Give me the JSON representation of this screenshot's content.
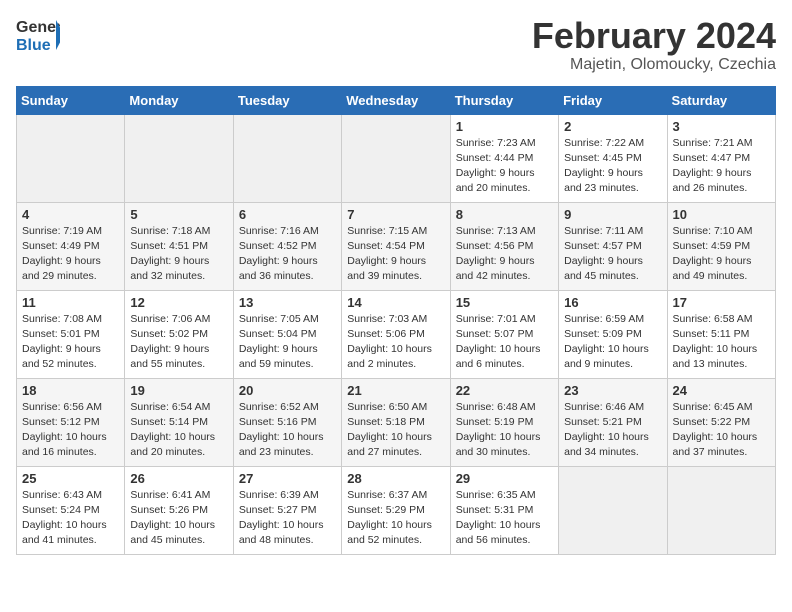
{
  "header": {
    "logo_line1": "General",
    "logo_line2": "Blue",
    "month": "February 2024",
    "location": "Majetin, Olomoucky, Czechia"
  },
  "weekdays": [
    "Sunday",
    "Monday",
    "Tuesday",
    "Wednesday",
    "Thursday",
    "Friday",
    "Saturday"
  ],
  "weeks": [
    [
      {
        "day": "",
        "info": ""
      },
      {
        "day": "",
        "info": ""
      },
      {
        "day": "",
        "info": ""
      },
      {
        "day": "",
        "info": ""
      },
      {
        "day": "1",
        "info": "Sunrise: 7:23 AM\nSunset: 4:44 PM\nDaylight: 9 hours\nand 20 minutes."
      },
      {
        "day": "2",
        "info": "Sunrise: 7:22 AM\nSunset: 4:45 PM\nDaylight: 9 hours\nand 23 minutes."
      },
      {
        "day": "3",
        "info": "Sunrise: 7:21 AM\nSunset: 4:47 PM\nDaylight: 9 hours\nand 26 minutes."
      }
    ],
    [
      {
        "day": "4",
        "info": "Sunrise: 7:19 AM\nSunset: 4:49 PM\nDaylight: 9 hours\nand 29 minutes."
      },
      {
        "day": "5",
        "info": "Sunrise: 7:18 AM\nSunset: 4:51 PM\nDaylight: 9 hours\nand 32 minutes."
      },
      {
        "day": "6",
        "info": "Sunrise: 7:16 AM\nSunset: 4:52 PM\nDaylight: 9 hours\nand 36 minutes."
      },
      {
        "day": "7",
        "info": "Sunrise: 7:15 AM\nSunset: 4:54 PM\nDaylight: 9 hours\nand 39 minutes."
      },
      {
        "day": "8",
        "info": "Sunrise: 7:13 AM\nSunset: 4:56 PM\nDaylight: 9 hours\nand 42 minutes."
      },
      {
        "day": "9",
        "info": "Sunrise: 7:11 AM\nSunset: 4:57 PM\nDaylight: 9 hours\nand 45 minutes."
      },
      {
        "day": "10",
        "info": "Sunrise: 7:10 AM\nSunset: 4:59 PM\nDaylight: 9 hours\nand 49 minutes."
      }
    ],
    [
      {
        "day": "11",
        "info": "Sunrise: 7:08 AM\nSunset: 5:01 PM\nDaylight: 9 hours\nand 52 minutes."
      },
      {
        "day": "12",
        "info": "Sunrise: 7:06 AM\nSunset: 5:02 PM\nDaylight: 9 hours\nand 55 minutes."
      },
      {
        "day": "13",
        "info": "Sunrise: 7:05 AM\nSunset: 5:04 PM\nDaylight: 9 hours\nand 59 minutes."
      },
      {
        "day": "14",
        "info": "Sunrise: 7:03 AM\nSunset: 5:06 PM\nDaylight: 10 hours\nand 2 minutes."
      },
      {
        "day": "15",
        "info": "Sunrise: 7:01 AM\nSunset: 5:07 PM\nDaylight: 10 hours\nand 6 minutes."
      },
      {
        "day": "16",
        "info": "Sunrise: 6:59 AM\nSunset: 5:09 PM\nDaylight: 10 hours\nand 9 minutes."
      },
      {
        "day": "17",
        "info": "Sunrise: 6:58 AM\nSunset: 5:11 PM\nDaylight: 10 hours\nand 13 minutes."
      }
    ],
    [
      {
        "day": "18",
        "info": "Sunrise: 6:56 AM\nSunset: 5:12 PM\nDaylight: 10 hours\nand 16 minutes."
      },
      {
        "day": "19",
        "info": "Sunrise: 6:54 AM\nSunset: 5:14 PM\nDaylight: 10 hours\nand 20 minutes."
      },
      {
        "day": "20",
        "info": "Sunrise: 6:52 AM\nSunset: 5:16 PM\nDaylight: 10 hours\nand 23 minutes."
      },
      {
        "day": "21",
        "info": "Sunrise: 6:50 AM\nSunset: 5:18 PM\nDaylight: 10 hours\nand 27 minutes."
      },
      {
        "day": "22",
        "info": "Sunrise: 6:48 AM\nSunset: 5:19 PM\nDaylight: 10 hours\nand 30 minutes."
      },
      {
        "day": "23",
        "info": "Sunrise: 6:46 AM\nSunset: 5:21 PM\nDaylight: 10 hours\nand 34 minutes."
      },
      {
        "day": "24",
        "info": "Sunrise: 6:45 AM\nSunset: 5:22 PM\nDaylight: 10 hours\nand 37 minutes."
      }
    ],
    [
      {
        "day": "25",
        "info": "Sunrise: 6:43 AM\nSunset: 5:24 PM\nDaylight: 10 hours\nand 41 minutes."
      },
      {
        "day": "26",
        "info": "Sunrise: 6:41 AM\nSunset: 5:26 PM\nDaylight: 10 hours\nand 45 minutes."
      },
      {
        "day": "27",
        "info": "Sunrise: 6:39 AM\nSunset: 5:27 PM\nDaylight: 10 hours\nand 48 minutes."
      },
      {
        "day": "28",
        "info": "Sunrise: 6:37 AM\nSunset: 5:29 PM\nDaylight: 10 hours\nand 52 minutes."
      },
      {
        "day": "29",
        "info": "Sunrise: 6:35 AM\nSunset: 5:31 PM\nDaylight: 10 hours\nand 56 minutes."
      },
      {
        "day": "",
        "info": ""
      },
      {
        "day": "",
        "info": ""
      }
    ]
  ]
}
